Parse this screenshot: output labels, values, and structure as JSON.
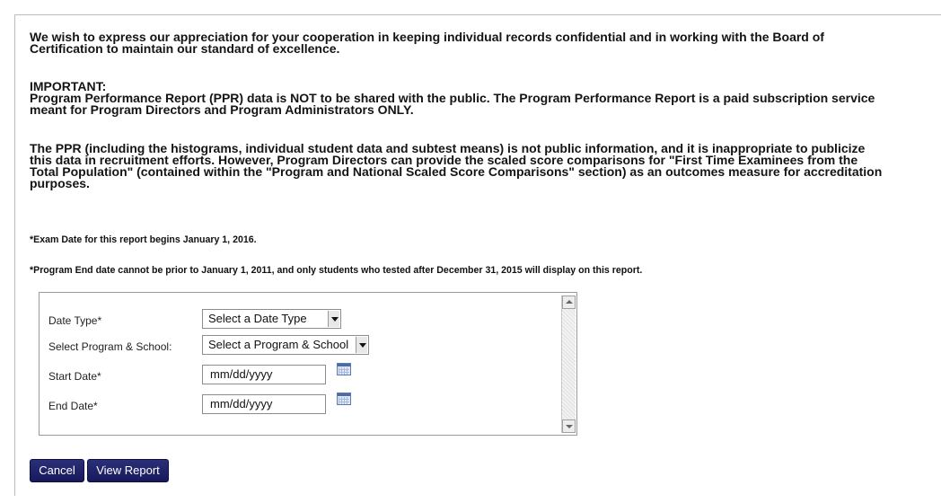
{
  "content": {
    "appreciation": "We wish to express our appreciation for your cooperation in keeping individual records confidential and in working with the Board of\nCertification to maintain our standard of excellence.",
    "important_block": "IMPORTANT:\nProgram Performance Report (PPR) data is NOT to be shared with the public. The Program Performance Report is a paid subscription service\nmeant for Program Directors and Program Administrators ONLY.",
    "ppr_block": "The PPR (including the histograms, individual student data and subtest means) is not public information, and it is inappropriate to publicize\nthis data in recruitment efforts. However, Program Directors can provide the scaled score comparisons for \"First Time Examinees from the\nTotal Population\" (contained within the \"Program and National Scaled Score Comparisons\" section) as an outcomes measure for accreditation\npurposes.",
    "note_exam_date": "*Exam Date for this report begins January 1, 2016.",
    "note_program_end": "*Program End date cannot be prior to January 1, 2011, and only students who tested after December 31, 2015 will display on this report."
  },
  "form": {
    "date_type": {
      "label": "Date Type*",
      "selected": "Select a Date Type"
    },
    "program_school": {
      "label": "Select Program & School:",
      "selected": "Select a Program & School"
    },
    "start_date": {
      "label": "Start Date*",
      "value": "mm/dd/yyyy"
    },
    "end_date": {
      "label": "End Date*",
      "value": "mm/dd/yyyy"
    }
  },
  "buttons": {
    "cancel": "Cancel",
    "view_report": "View Report"
  },
  "colors": {
    "button_bg": "#1f2270",
    "border": "#bcbcbc"
  },
  "icons": {
    "calendar": "calendar-icon",
    "dropdown": "chevron-down-icon"
  }
}
